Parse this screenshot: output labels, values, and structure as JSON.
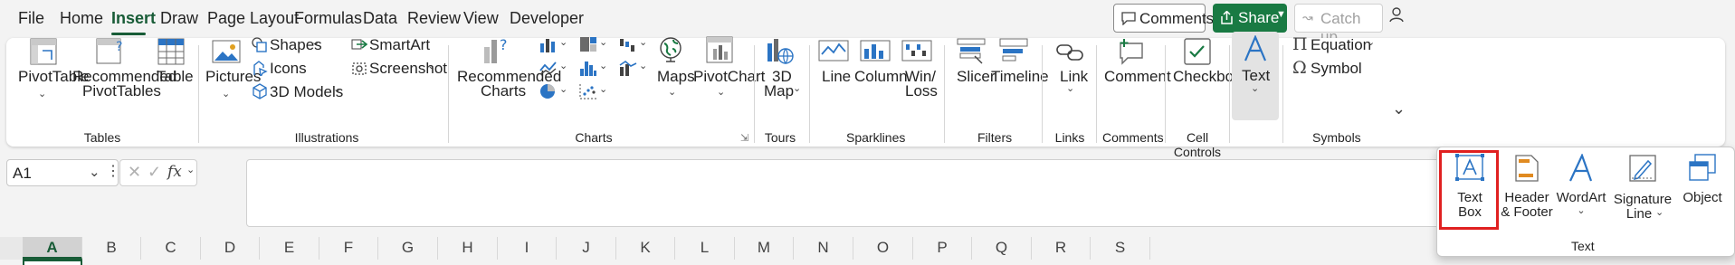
{
  "menu": {
    "tabs": [
      "File",
      "Home",
      "Insert",
      "Draw",
      "Page Layout",
      "Formulas",
      "Data",
      "Review",
      "View",
      "Developer"
    ],
    "active": "Insert"
  },
  "topright": {
    "comments": "Comments",
    "share": "Share",
    "catchup": "Catch up"
  },
  "ribbon": {
    "tables": {
      "pivottable": "PivotTable",
      "recommended1": "Recommended",
      "recommended2": "PivotTables",
      "table": "Table",
      "label": "Tables"
    },
    "illustrations": {
      "pictures": "Pictures",
      "shapes": "Shapes",
      "icons": "Icons",
      "models": "3D Models",
      "smartart": "SmartArt",
      "screenshot": "Screenshot",
      "label": "Illustrations"
    },
    "charts": {
      "rec1": "Recommended",
      "rec2": "Charts",
      "maps": "Maps",
      "pivotchart": "PivotChart",
      "label": "Charts"
    },
    "tours": {
      "map1": "3D",
      "map2": "Map",
      "label": "Tours"
    },
    "sparklines": {
      "line": "Line",
      "column": "Column",
      "winloss1": "Win/",
      "winloss2": "Loss",
      "label": "Sparklines"
    },
    "filters": {
      "slicer": "Slicer",
      "timeline": "Timeline",
      "label": "Filters"
    },
    "links": {
      "link": "Link",
      "label": "Links"
    },
    "comments": {
      "comment": "Comment",
      "label": "Comments"
    },
    "cellcontrols": {
      "checkbox": "Checkbox",
      "label": "Cell Controls"
    },
    "text": {
      "text": "Text"
    },
    "symbols": {
      "equation": "Equation",
      "symbol": "Symbol",
      "label": "Symbols"
    }
  },
  "namebox": {
    "value": "A1"
  },
  "fx": "fx",
  "columns": [
    "A",
    "B",
    "C",
    "D",
    "E",
    "F",
    "G",
    "H",
    "I",
    "J",
    "K",
    "L",
    "M",
    "N",
    "O",
    "P",
    "Q",
    "R",
    "S"
  ],
  "popup": {
    "textbox1": "Text",
    "textbox2": "Box",
    "header1": "Header",
    "header2": "& Footer",
    "wordart": "WordArt",
    "sig1": "Signature",
    "sig2": "Line",
    "object": "Object",
    "label": "Text"
  },
  "colors": {
    "accent": "#185c37",
    "share": "#197a43",
    "icon_blue": "#2b74c4",
    "highlight": "#e02020"
  }
}
